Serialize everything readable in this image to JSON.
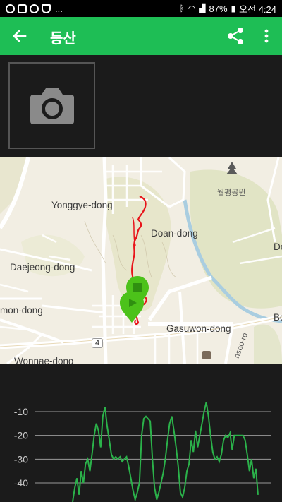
{
  "status_bar": {
    "notification_more": "...",
    "battery": "87%",
    "time": "오전 4:24"
  },
  "app_bar": {
    "title": "등산"
  },
  "photo": {
    "icon": "camera-icon"
  },
  "map": {
    "labels": {
      "yonggye": "Yonggye-dong",
      "doan": "Doan-dong",
      "daejeong": "Daejeong-dong",
      "mon": "mon-dong",
      "gasuwon": "Gasuwon-dong",
      "wonnae": "Wonnae-dong",
      "wolpyeong": "월평공원",
      "do": "Do",
      "bo": "Bo",
      "route4": "4",
      "gyeonseoro": "nseo-ro"
    },
    "colors": {
      "track": "#e8141a",
      "marker": "#4cc21a"
    }
  },
  "chart_data": {
    "type": "line",
    "y_ticks": [
      "-10",
      "-20",
      "-30",
      "-40"
    ],
    "ylim": [
      -45,
      -5
    ],
    "grid": true,
    "color": "#2bb24a",
    "series": [
      {
        "values": [
          -48,
          -42,
          -38,
          -45,
          -35,
          -40,
          -32,
          -30,
          -35,
          -28,
          -20,
          -15,
          -18,
          -25,
          -12,
          -8,
          -16,
          -22,
          -28,
          -30,
          -29,
          -30,
          -29,
          -31,
          -30,
          -29,
          -33,
          -38,
          -43,
          -47,
          -44,
          -40,
          -20,
          -13,
          -12,
          -13,
          -14,
          -30,
          -42,
          -47,
          -44,
          -40,
          -36,
          -30,
          -22,
          -15,
          -12,
          -18,
          -25,
          -33,
          -44,
          -46,
          -42,
          -35,
          -32,
          -22,
          -27,
          -18,
          -25,
          -20,
          -15,
          -10,
          -6,
          -12,
          -20,
          -27,
          -30,
          -29,
          -31,
          -28,
          -22,
          -20,
          -21,
          -19,
          -26,
          -20,
          -20,
          -20,
          -20,
          -20,
          -22,
          -28,
          -35,
          -30,
          -38,
          -34,
          -45
        ]
      }
    ]
  }
}
